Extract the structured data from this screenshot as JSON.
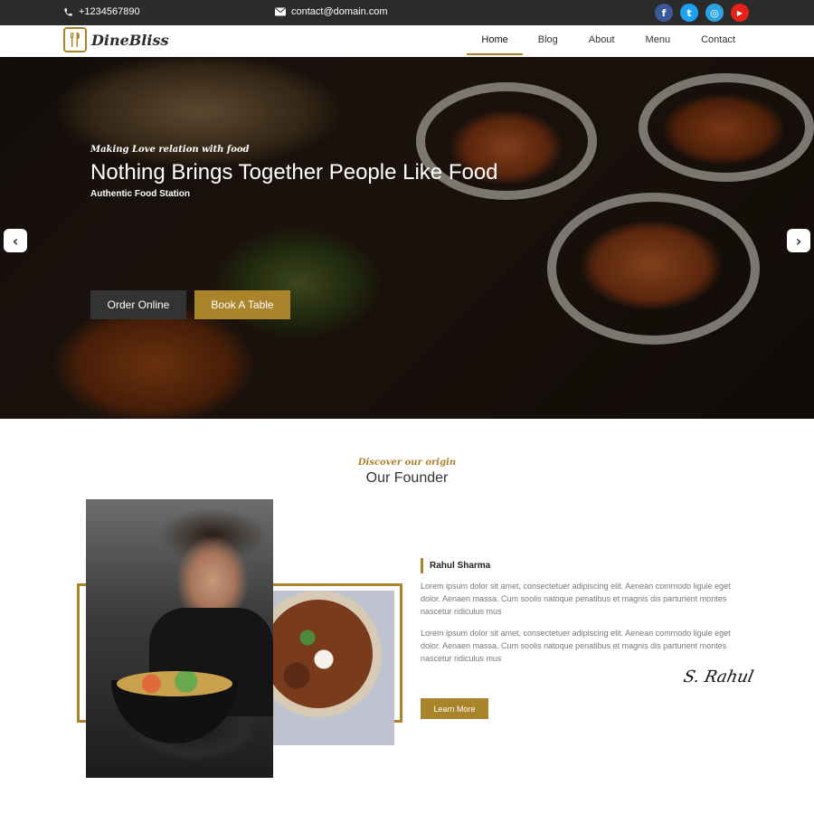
{
  "topbar": {
    "phone": "+1234567890",
    "email": "contact@domain.com",
    "socials": [
      {
        "name": "facebook",
        "glyph": "f",
        "color": "#3b5998"
      },
      {
        "name": "twitter",
        "glyph": "t",
        "color": "#1da1f2"
      },
      {
        "name": "instagram",
        "glyph": "◎",
        "color": "#2aa3e0"
      },
      {
        "name": "youtube",
        "glyph": "▶",
        "color": "#e62117"
      }
    ]
  },
  "brand": {
    "name": "DineBliss",
    "accent": "#a9842b"
  },
  "nav": {
    "items": [
      "Home",
      "Blog",
      "About",
      "Menu",
      "Contact"
    ],
    "active": "Home"
  },
  "hero": {
    "tagline": "Making Love relation with food",
    "title": "Nothing Brings Together People Like Food",
    "subtitle": "Authentic Food Station",
    "order_label": "Order Online",
    "book_label": "Book A Table",
    "prev_icon": "‹",
    "next_icon": "›"
  },
  "founder": {
    "tagline": "Discover our origin",
    "title": "Our Founder",
    "name": "Rahul Sharma",
    "para1": "Lorem ipsum dolor sit amet, consectetuer adipiscing elit. Aenean commodo ligule eget dolor. Aenaen massa. Cum soolis natoque penatibus et magnis dis parturient montes nascetur ridiculus mus",
    "para2": "Lorem ipsum dolor sit amet, consectetuer adipiscing elit. Aenean commodo ligule eget dolor. Aenaen massa. Cum soolis natoque penatibus et magnis dis parturient montes nascetur ridiculus mus",
    "signature": "S. Rahul",
    "learn_more_label": "Learn More"
  }
}
